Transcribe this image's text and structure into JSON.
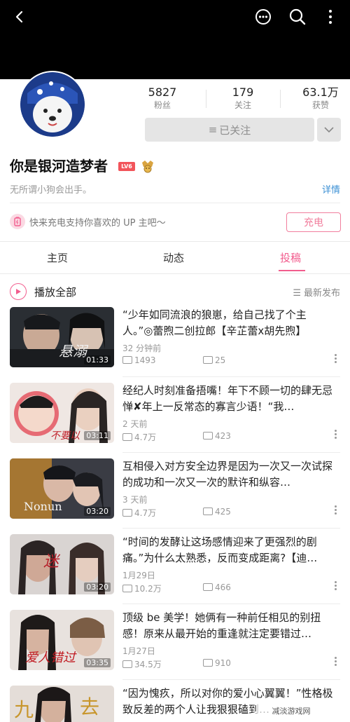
{
  "topbar": {
    "icons": [
      "back-icon",
      "message-icon",
      "search-icon",
      "more-vertical-icon"
    ]
  },
  "profile": {
    "stats": [
      {
        "value": "5827",
        "label": "粉丝"
      },
      {
        "value": "179",
        "label": "关注"
      },
      {
        "value": "63.1万",
        "label": "获赞"
      }
    ],
    "follow_label": "已关注",
    "username": "你是银河造梦者",
    "level_badge": "LV6",
    "bio": "无所谓小狗会出手。",
    "detail_link": "详情"
  },
  "charge": {
    "text": "快来充电支持你喜欢的 UP 主吧～",
    "button": "充电"
  },
  "tabs": [
    {
      "label": "主页"
    },
    {
      "label": "动态"
    },
    {
      "label": "投稿"
    }
  ],
  "active_tab": "投稿",
  "list_header": {
    "play_all": "播放全部",
    "sort": "最新发布"
  },
  "videos": [
    {
      "title": "“少年如同流浪的狼崽，给自己找了个主人。”◎蕾煦二创拉郎【辛芷蕾x胡先煦】",
      "time": "32 分钟前",
      "views": "1493",
      "comments": "25",
      "duration": "01:33"
    },
    {
      "title": "经纪人时刻准备捂嘴！年下不顾一切的肆无忌惮✘年上一反常态的寡言少语！“我…",
      "time": "2 天前",
      "views": "4.7万",
      "comments": "423",
      "duration": "03:11"
    },
    {
      "title": "互相侵入对方安全边界是因为一次又一次试探的成功和一次又一次的默许和纵容…",
      "time": "3 天前",
      "views": "4.7万",
      "comments": "425",
      "duration": "03:20"
    },
    {
      "title": "“时间的发酵让这场感情迎来了更强烈的剧痛。”为什么太熟悉，反而变成距离?【迪…",
      "time": "1月29日",
      "views": "10.2万",
      "comments": "466",
      "duration": "03:20"
    },
    {
      "title": "顶级 be 美学！她俩有一种前任相见的别扭感！原来从最开始的重逢就注定要错过…",
      "time": "1月27日",
      "views": "34.5万",
      "comments": "910",
      "duration": "03:35"
    },
    {
      "title": "“因为愧疚，所以对你的爱小心翼翼！”性格极致反差的两个人让我狠狠磕到…",
      "time": "",
      "views": "",
      "comments": "",
      "duration": ""
    }
  ],
  "watermark": "减淡游戏网",
  "colors": {
    "accent": "#f25d8e",
    "link": "#3a8fd4",
    "badge": "#f2545a"
  }
}
